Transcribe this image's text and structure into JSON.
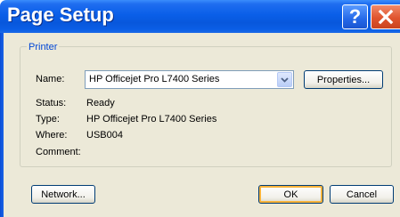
{
  "window": {
    "title": "Page Setup",
    "help_label": "?",
    "close_label": "✕"
  },
  "printer": {
    "group_label": "Printer",
    "name_label": "Name:",
    "name_value": "HP Officejet Pro L7400 Series",
    "properties_label": "Properties...",
    "status_label": "Status:",
    "status_value": "Ready",
    "type_label": "Type:",
    "type_value": "HP Officejet Pro L7400 Series",
    "where_label": "Where:",
    "where_value": "USB004",
    "comment_label": "Comment:",
    "comment_value": ""
  },
  "buttons": {
    "network": "Network...",
    "ok": "OK",
    "cancel": "Cancel"
  },
  "colors": {
    "titlebar": "#0a5fe8",
    "client": "#ece9d8",
    "group_label": "#0046d5",
    "close": "#e0542e"
  }
}
